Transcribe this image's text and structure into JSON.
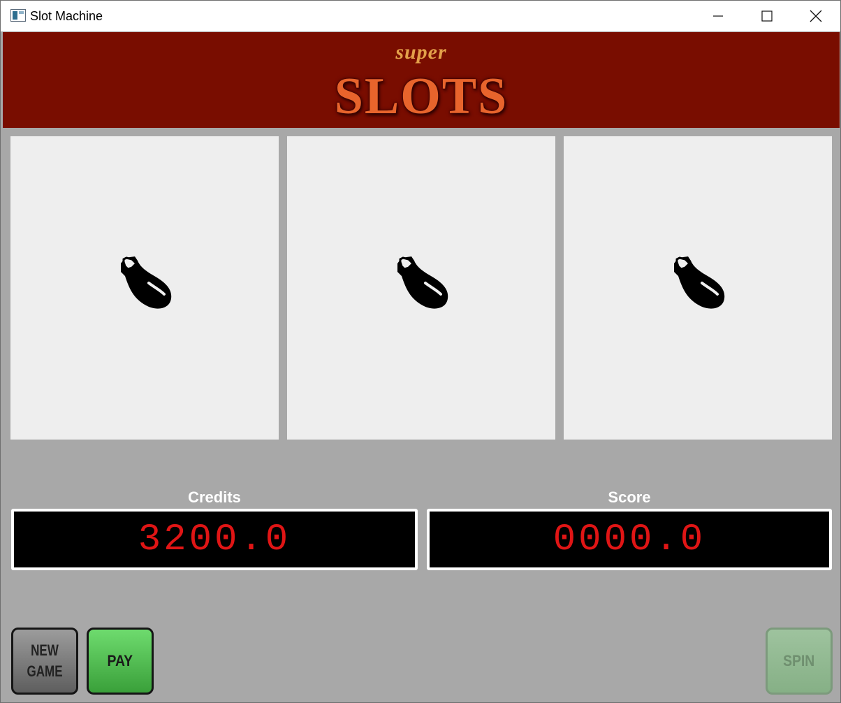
{
  "window": {
    "title": "Slot Machine",
    "controls": [
      "minimize",
      "maximize",
      "close"
    ]
  },
  "header": {
    "super_text": "super",
    "slots_text": "SLOTS",
    "colors": {
      "background": "#790d00",
      "super": "#e3a04a",
      "slots": "#e8642c"
    }
  },
  "reels": [
    {
      "symbol": "eggplant-icon"
    },
    {
      "symbol": "eggplant-icon"
    },
    {
      "symbol": "eggplant-icon"
    }
  ],
  "meters": {
    "credits": {
      "label": "Credits",
      "value": "3200.0"
    },
    "score": {
      "label": "Score",
      "value": "0000.0"
    },
    "digit_color": "#e01515"
  },
  "buttons": {
    "new_game_line1": "NEW",
    "new_game_line2": "GAME",
    "pay": "PAY",
    "spin": "SPIN"
  },
  "state": {
    "spin_enabled": false
  }
}
